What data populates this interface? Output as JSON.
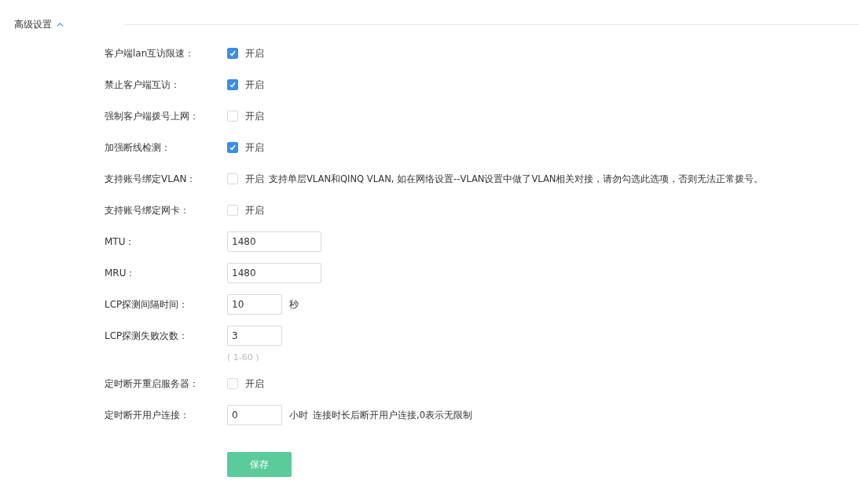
{
  "section": {
    "title": "高级设置",
    "expanded": true
  },
  "fields": [
    {
      "kind": "checkbox",
      "label": "客户端lan互访限速：",
      "checked": true,
      "option": "开启"
    },
    {
      "kind": "checkbox",
      "label": "禁止客户端互访：",
      "checked": true,
      "option": "开启"
    },
    {
      "kind": "checkbox",
      "label": "强制客户端拨号上网：",
      "checked": false,
      "option": "开启"
    },
    {
      "kind": "checkbox",
      "label": "加强断线检测：",
      "checked": true,
      "option": "开启"
    },
    {
      "kind": "checkbox",
      "label": "支持账号绑定VLAN：",
      "checked": false,
      "option": "开启",
      "note": "支持单层VLAN和QINQ VLAN, 如在网络设置--VLAN设置中做了VLAN相关对接，请勿勾选此选项，否则无法正常拨号。"
    },
    {
      "kind": "checkbox",
      "label": "支持账号绑定网卡：",
      "checked": false,
      "option": "开启"
    },
    {
      "kind": "text",
      "label": "MTU：",
      "value": "1480"
    },
    {
      "kind": "text",
      "label": "MRU：",
      "value": "1480"
    },
    {
      "kind": "number",
      "label": "LCP探测间隔时间：",
      "value": "10",
      "unit": "秒"
    },
    {
      "kind": "number",
      "label": "LCP探测失败次数：",
      "value": "3",
      "hint": "( 1-60 )"
    },
    {
      "kind": "checkbox",
      "label": "定时断开重启服务器：",
      "checked": false,
      "option": "开启"
    },
    {
      "kind": "number",
      "label": "定时断开用户连接：",
      "value": "0",
      "unit": "小时",
      "note": "连接时长后断开用户连接,0表示无限制"
    }
  ],
  "save_button": "保存"
}
